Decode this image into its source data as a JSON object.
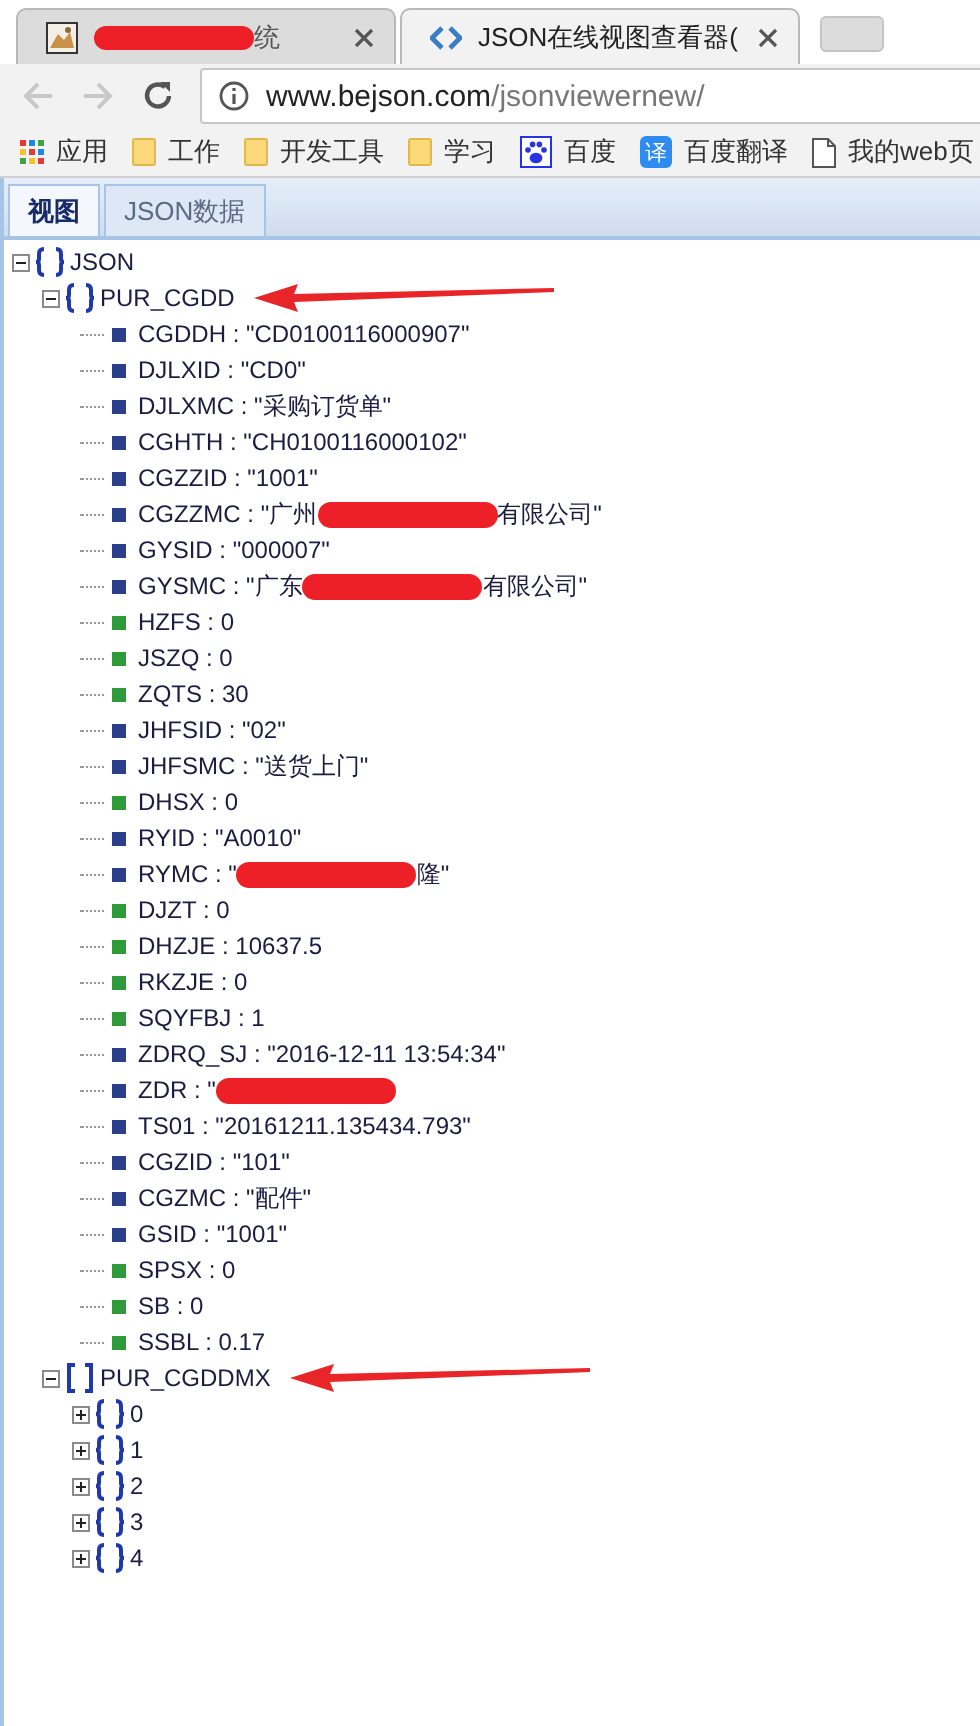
{
  "browser": {
    "tabs": [
      {
        "selected": false,
        "kind": "picture",
        "segments": [
          {
            "kind": "redaction"
          },
          {
            "kind": "text",
            "text": "统"
          }
        ]
      },
      {
        "selected": true,
        "kind": "code",
        "segments": [
          {
            "kind": "text",
            "text": "JSON在线视图查看器("
          }
        ]
      }
    ],
    "address": {
      "host": "www.bejson.com",
      "path": "/jsonviewernew/"
    },
    "bookmarks": [
      {
        "kind": "apps",
        "label": "应用"
      },
      {
        "kind": "folder",
        "label": "工作"
      },
      {
        "kind": "folder",
        "label": "开发工具"
      },
      {
        "kind": "folder",
        "label": "学习"
      },
      {
        "kind": "paw",
        "label": "百度"
      },
      {
        "kind": "badge",
        "badge": "译",
        "label": "百度翻译"
      },
      {
        "kind": "page",
        "label": "我的web页"
      }
    ]
  },
  "view_tabs": [
    {
      "label": "视图",
      "selected": true
    },
    {
      "label": "JSON数据",
      "selected": false
    }
  ],
  "tree": {
    "label": "JSON",
    "kind": "object",
    "expanded": true,
    "children": [
      {
        "label": "PUR_CGDD",
        "kind": "object",
        "expanded": true,
        "annotated": true,
        "children": [
          {
            "kind": "string",
            "text": "CGDDH : \"CD0100116000907\""
          },
          {
            "kind": "string",
            "text": "DJLXID : \"CD0\""
          },
          {
            "kind": "string",
            "text": "DJLXMC : \"采购订货单\""
          },
          {
            "kind": "string",
            "text": "CGHTH : \"CH0100116000102\""
          },
          {
            "kind": "string",
            "text": "CGZZID : \"1001\""
          },
          {
            "kind": "string",
            "segments": [
              {
                "kind": "text",
                "text": "CGZZMC : \"广州"
              },
              {
                "kind": "redaction"
              },
              {
                "kind": "text",
                "text": "有限公司\""
              }
            ]
          },
          {
            "kind": "string",
            "text": "GYSID : \"000007\""
          },
          {
            "kind": "string",
            "segments": [
              {
                "kind": "text",
                "text": "GYSMC : \"广东"
              },
              {
                "kind": "redaction"
              },
              {
                "kind": "text",
                "text": "有限公司\""
              }
            ]
          },
          {
            "kind": "number",
            "text": "HZFS : 0"
          },
          {
            "kind": "number",
            "text": "JSZQ : 0"
          },
          {
            "kind": "number",
            "text": "ZQTS : 30"
          },
          {
            "kind": "string",
            "text": "JHFSID : \"02\""
          },
          {
            "kind": "string",
            "text": "JHFSMC : \"送货上门\""
          },
          {
            "kind": "number",
            "text": "DHSX : 0"
          },
          {
            "kind": "string",
            "text": "RYID : \"A0010\""
          },
          {
            "kind": "string",
            "segments": [
              {
                "kind": "text",
                "text": "RYMC : \""
              },
              {
                "kind": "redaction"
              },
              {
                "kind": "text",
                "text": "隆\""
              }
            ]
          },
          {
            "kind": "number",
            "text": "DJZT : 0"
          },
          {
            "kind": "number",
            "text": "DHZJE : 10637.5"
          },
          {
            "kind": "number",
            "text": "RKZJE : 0"
          },
          {
            "kind": "number",
            "text": "SQYFBJ : 1"
          },
          {
            "kind": "string",
            "text": "ZDRQ_SJ : \"2016-12-11 13:54:34\""
          },
          {
            "kind": "string",
            "segments": [
              {
                "kind": "text",
                "text": "ZDR : \""
              },
              {
                "kind": "redaction"
              }
            ]
          },
          {
            "kind": "string",
            "text": "TS01 : \"20161211.135434.793\""
          },
          {
            "kind": "string",
            "text": "CGZID : \"101\""
          },
          {
            "kind": "string",
            "text": "CGZMC : \"配件\""
          },
          {
            "kind": "string",
            "text": "GSID : \"1001\""
          },
          {
            "kind": "number",
            "text": "SPSX : 0"
          },
          {
            "kind": "number",
            "text": "SB : 0"
          },
          {
            "kind": "number",
            "text": "SSBL : 0.17"
          }
        ]
      },
      {
        "label": "PUR_CGDDMX",
        "kind": "array",
        "expanded": true,
        "annotated": true,
        "children": [
          {
            "label": "0",
            "kind": "object",
            "expanded": false
          },
          {
            "label": "1",
            "kind": "object",
            "expanded": false
          },
          {
            "label": "2",
            "kind": "object",
            "expanded": false
          },
          {
            "label": "3",
            "kind": "object",
            "expanded": false
          },
          {
            "label": "4",
            "kind": "object",
            "expanded": false
          }
        ]
      }
    ]
  }
}
